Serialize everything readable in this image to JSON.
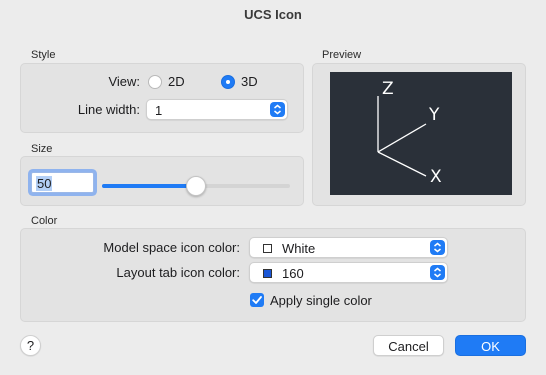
{
  "window": {
    "title": "UCS Icon"
  },
  "style": {
    "section_label": "Style",
    "view_label": "View:",
    "view_options": [
      "2D",
      "3D"
    ],
    "view_selected": "3D",
    "line_width_label": "Line width:",
    "line_width_value": "1"
  },
  "size": {
    "section_label": "Size",
    "value": "50",
    "slider_fraction": 0.5
  },
  "preview": {
    "section_label": "Preview",
    "axis_z": "Z",
    "axis_y": "Y",
    "axis_x": "X",
    "background": "#2a3039",
    "line_color": "#ffffff"
  },
  "color": {
    "section_label": "Color",
    "model_space_label": "Model space icon color:",
    "model_space_value": "White",
    "model_space_swatch": "#ffffff",
    "layout_tab_label": "Layout tab icon color:",
    "layout_tab_value": "160",
    "layout_tab_swatch": "#1a56d6",
    "apply_single_label": "Apply single color",
    "apply_single_checked": true
  },
  "buttons": {
    "help": "?",
    "cancel": "Cancel",
    "ok": "OK"
  },
  "accent": "#1f7bf5"
}
